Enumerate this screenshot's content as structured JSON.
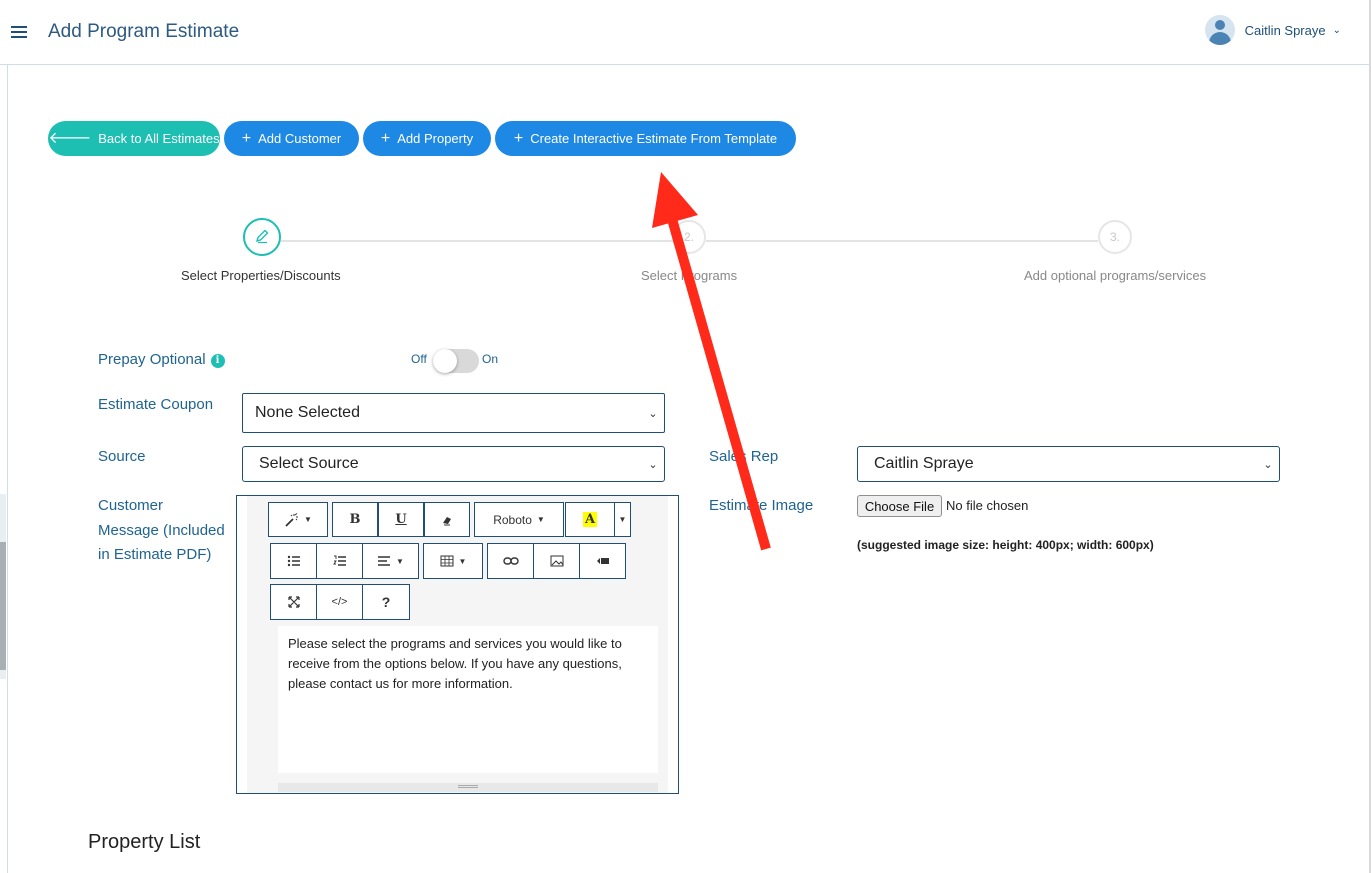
{
  "header": {
    "title": "Add Program Estimate",
    "user_name": "Caitlin Spraye"
  },
  "actions": {
    "back": "Back to All Estimates",
    "add_customer": "Add Customer",
    "add_property": "Add Property",
    "create_interactive": "Create Interactive Estimate From Template"
  },
  "steps": [
    {
      "number": "",
      "label": "Select Properties/Discounts"
    },
    {
      "number": "2.",
      "label": "Select Programs"
    },
    {
      "number": "3.",
      "label": "Add optional programs/services"
    }
  ],
  "form": {
    "prepay_label": "Prepay Optional",
    "toggle_off": "Off",
    "toggle_on": "On",
    "prepay_value": "Off",
    "coupon_label": "Estimate Coupon",
    "coupon_value": "None Selected",
    "source_label": "Source",
    "source_value": "Select Source",
    "sales_rep_label": "Sales Rep",
    "sales_rep_value": "Caitlin Spraye",
    "message_label": "Customer Message (Included in Estimate PDF)",
    "image_label": "Estimate Image",
    "choose_file": "Choose File",
    "file_status": "No file chosen",
    "image_note": "(suggested image size: height: 400px; width: 600px)"
  },
  "editor": {
    "font_name": "Roboto",
    "bold": "B",
    "underline": "U",
    "help": "?",
    "code": "</>",
    "color_letter": "A",
    "content": "Please select the programs and services you would like to receive from the options below. If you have any questions, please contact us for more information."
  },
  "section": {
    "property_list": "Property List"
  },
  "colors": {
    "teal": "#1dbfb3",
    "blue": "#1e88e5",
    "label_blue": "#1f6391",
    "annotation_red": "#ff2a1a"
  },
  "icons": [
    "menu-icon",
    "user-avatar-icon",
    "arrow-left-icon",
    "plus-icon",
    "pencil-icon",
    "info-icon",
    "magic-wand-icon",
    "eraser-icon",
    "unordered-list-icon",
    "ordered-list-icon",
    "align-icon",
    "table-icon",
    "link-icon",
    "picture-icon",
    "video-icon",
    "fullscreen-icon",
    "red-arrow-annotation"
  ]
}
